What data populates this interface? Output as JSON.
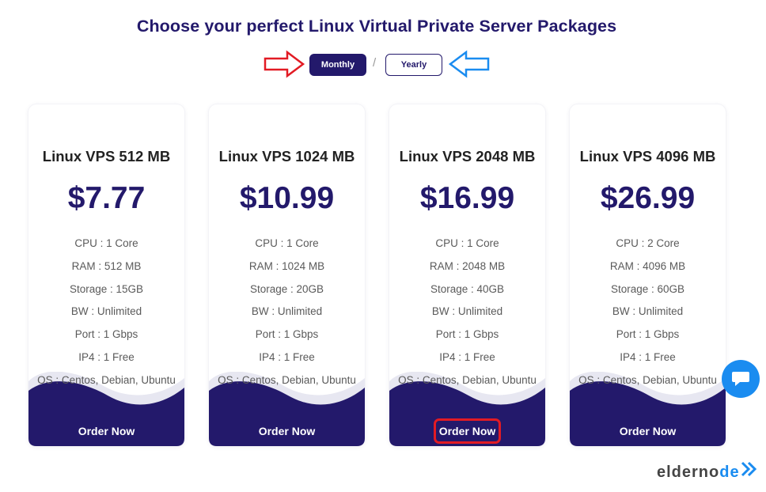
{
  "page": {
    "title": "Choose your perfect Linux Virtual Private Server Packages"
  },
  "billing_toggle": {
    "monthly_label": "Monthly",
    "separator": "/",
    "yearly_label": "Yearly",
    "selected": "Monthly"
  },
  "colors": {
    "brand": "#23196b",
    "annotation_red": "#e21b24",
    "annotation_blue": "#1a8cf0",
    "chat": "#1a8cf0"
  },
  "plans": [
    {
      "name": "Linux VPS 512 MB",
      "price": "$7.77",
      "features": [
        "CPU : 1 Core",
        "RAM : 512 MB",
        "Storage : 15GB",
        "BW : Unlimited",
        "Port : 1 Gbps",
        "IP4 : 1 Free",
        "OS : Centos, Debian, Ubuntu"
      ],
      "order_label": "Order Now"
    },
    {
      "name": "Linux VPS 1024 MB",
      "price": "$10.99",
      "features": [
        "CPU : 1 Core",
        "RAM : 1024 MB",
        "Storage : 20GB",
        "BW : Unlimited",
        "Port : 1 Gbps",
        "IP4 : 1 Free",
        "OS : Centos, Debian, Ubuntu"
      ],
      "order_label": "Order Now"
    },
    {
      "name": "Linux VPS 2048 MB",
      "price": "$16.99",
      "features": [
        "CPU : 1 Core",
        "RAM : 2048 MB",
        "Storage : 40GB",
        "BW : Unlimited",
        "Port : 1 Gbps",
        "IP4 : 1 Free",
        "OS : Centos, Debian, Ubuntu"
      ],
      "order_label": "Order Now"
    },
    {
      "name": "Linux VPS 4096 MB",
      "price": "$26.99",
      "features": [
        "CPU : 2 Core",
        "RAM : 4096 MB",
        "Storage : 60GB",
        "BW : Unlimited",
        "Port : 1 Gbps",
        "IP4 : 1 Free",
        "OS : Centos, Debian, Ubuntu"
      ],
      "order_label": "Order Now"
    }
  ],
  "icons": {
    "chat": "chat-bubble-icon",
    "red_arrow": "arrow-right-icon",
    "blue_arrow": "arrow-left-icon",
    "logo_mark": "double-chevron-icon"
  },
  "logo": {
    "text_main": "elderno",
    "text_accent": "de"
  }
}
